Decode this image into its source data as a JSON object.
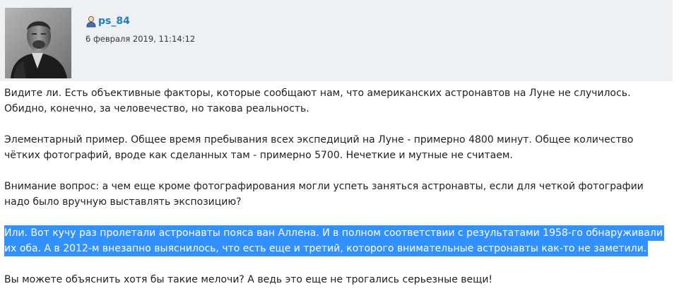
{
  "post": {
    "author": "ps_84",
    "date": "6 февраля 2019, 11:14:12",
    "icons": {
      "author": "user-icon"
    },
    "colors": {
      "header_bg": "#eef1f4",
      "author_link": "#1f7fc4",
      "selection": "#3390ff"
    },
    "paragraphs": [
      {
        "lines": [
          "Видите ли. Есть объективные факторы, которые сообщают нам, что американских астронавтов на Луне не случилось.",
          "Обидно, конечно, за человечество, но такова реальность."
        ]
      },
      {
        "lines": [
          "Элементарный пример. Общее время пребывания всех экспедиций на Луне - примерно 4800 минут. Общее количество",
          "чётких фотографий, вроде как сделанных там - примерно 5700. Нечеткие и мутные не считаем."
        ]
      },
      {
        "lines": [
          "Внимание вопрос: а чем еще кроме фотографирования могли успеть заняться астронавты, если для четкой фотографии",
          "надо было вручную выставлять экспозицию?"
        ]
      },
      {
        "selected": true,
        "lines": [
          "Или. Вот кучу раз пролетали астронавты пояса ван Аллена. И в полном соответствии с результатами 1958-го обнаруживали",
          "их оба. А в 2012-м внезапно выяснилось, что есть еще и третий, которого внимательные астронавты как-то не заметили."
        ]
      },
      {
        "lines": [
          "Вы можете объяснить хотя бы такие мелочи? А ведь это еще не трогались серьезные вещи!"
        ]
      }
    ]
  }
}
